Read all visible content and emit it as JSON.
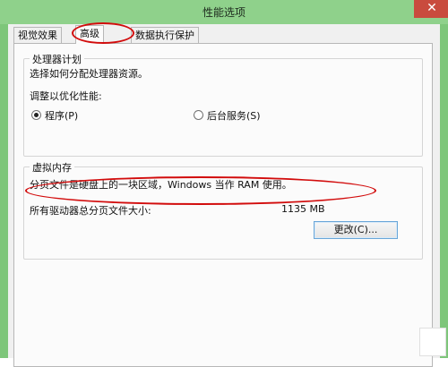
{
  "window": {
    "title": "性能选项",
    "close_glyph": "✕"
  },
  "tabs": [
    {
      "label": "视觉效果",
      "active": false
    },
    {
      "label": "高级",
      "active": true
    },
    {
      "label": "数据执行保护",
      "active": false
    }
  ],
  "processor": {
    "group_title": "处理器计划",
    "description": "选择如何分配处理器资源。",
    "optimize_label": "调整以优化性能:",
    "options": [
      {
        "label": "程序(P)",
        "checked": true
      },
      {
        "label": "后台服务(S)",
        "checked": false
      }
    ]
  },
  "virtual_memory": {
    "group_title": "虚拟内存",
    "description": "分页文件是硬盘上的一块区域，Windows 当作 RAM 使用。",
    "total_label": "所有驱动器总分页文件大小:",
    "total_value": "1135 MB",
    "change_button": "更改(C)..."
  },
  "colors": {
    "frame": "#7ec67a",
    "annotation": "#d20c0c"
  }
}
